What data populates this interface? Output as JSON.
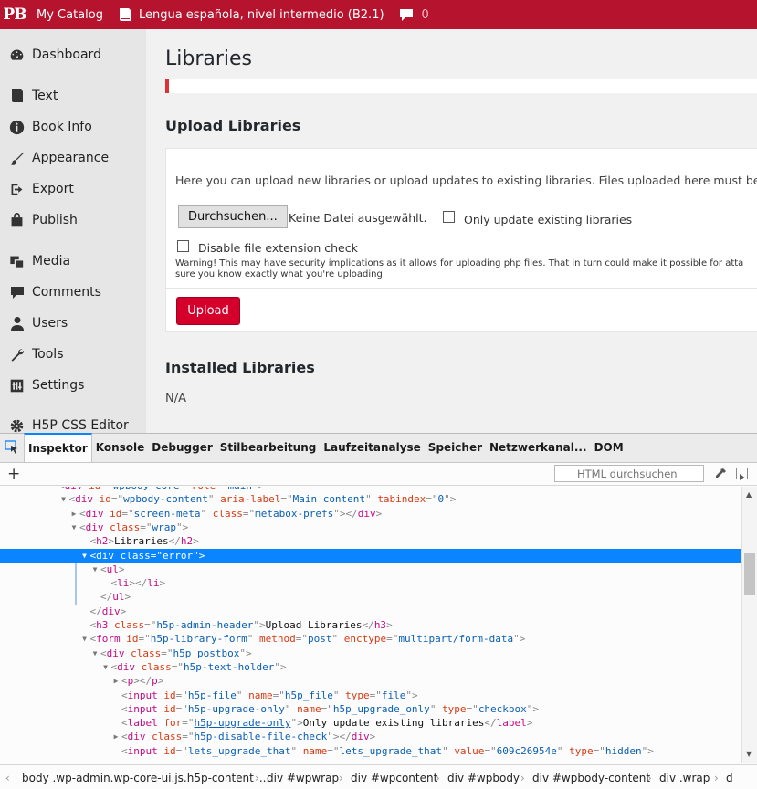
{
  "admin_bar": {
    "logo": "PB",
    "catalog": "My Catalog",
    "book": "Lengua española, nivel intermedio (B2.1)",
    "comments_count": "0"
  },
  "sidebar": {
    "items": [
      {
        "label": "Dashboard",
        "icon": "dashboard-icon"
      },
      {
        "label": "Text",
        "icon": "book-icon"
      },
      {
        "label": "Book Info",
        "icon": "info-icon"
      },
      {
        "label": "Appearance",
        "icon": "brush-icon"
      },
      {
        "label": "Export",
        "icon": "export-icon"
      },
      {
        "label": "Publish",
        "icon": "bag-icon"
      },
      {
        "label": "Media",
        "icon": "media-icon"
      },
      {
        "label": "Comments",
        "icon": "comment-icon"
      },
      {
        "label": "Users",
        "icon": "user-icon"
      },
      {
        "label": "Tools",
        "icon": "wrench-icon"
      },
      {
        "label": "Settings",
        "icon": "settings-icon"
      },
      {
        "label": "H5P CSS Editor",
        "icon": "gear-icon"
      }
    ]
  },
  "main": {
    "title": "Libraries",
    "upload_title": "Upload Libraries",
    "intro": "Here you can upload new libraries or upload updates to existing libraries. Files uploaded here must be in the",
    "file_button": "Durchsuchen...",
    "file_status": "Keine Datei ausgewählt.",
    "only_update_label": "Only update existing libraries",
    "disable_check_label": "Disable file extension check",
    "warning_line1": "Warning! This may have security implications as it allows for uploading php files. That in turn could make it possible for atta",
    "warning_line2": "sure you know exactly what you're uploading.",
    "upload_button": "Upload",
    "installed_title": "Installed Libraries",
    "installed_value": "N/A"
  },
  "devtools": {
    "tabs": [
      "Inspektor",
      "Konsole",
      "Debugger",
      "Stilbearbeitung",
      "Laufzeitanalyse",
      "Speicher",
      "Netzwerkanal...",
      "DOM"
    ],
    "search_placeholder": "HTML durchsuchen",
    "tree": [
      {
        "indent": 0,
        "tw": "none",
        "parts": [
          [
            "p",
            "<"
          ],
          [
            "tag",
            "div"
          ],
          [
            "t",
            " "
          ],
          [
            "attr",
            "id"
          ],
          [
            "p",
            "=\""
          ],
          [
            "val",
            "wpbody-core"
          ],
          [
            "p",
            "\" "
          ],
          [
            "attr",
            "role"
          ],
          [
            "p",
            "=\""
          ],
          [
            "val",
            "main"
          ],
          [
            "p",
            "\">"
          ]
        ]
      },
      {
        "indent": 1,
        "tw": "open",
        "parts": [
          [
            "p",
            "<"
          ],
          [
            "tag",
            "div"
          ],
          [
            "t",
            " "
          ],
          [
            "attr",
            "id"
          ],
          [
            "p",
            "=\""
          ],
          [
            "val",
            "wpbody-content"
          ],
          [
            "p",
            "\" "
          ],
          [
            "attr",
            "aria-label"
          ],
          [
            "p",
            "=\""
          ],
          [
            "val",
            "Main content"
          ],
          [
            "p",
            "\" "
          ],
          [
            "attr",
            "tabindex"
          ],
          [
            "p",
            "=\""
          ],
          [
            "val",
            "0"
          ],
          [
            "p",
            "\">"
          ]
        ]
      },
      {
        "indent": 2,
        "tw": "closed",
        "parts": [
          [
            "p",
            "<"
          ],
          [
            "tag",
            "div"
          ],
          [
            "t",
            " "
          ],
          [
            "attr",
            "id"
          ],
          [
            "p",
            "=\""
          ],
          [
            "val",
            "screen-meta"
          ],
          [
            "p",
            "\" "
          ],
          [
            "attr",
            "class"
          ],
          [
            "p",
            "=\""
          ],
          [
            "val",
            "metabox-prefs"
          ],
          [
            "p",
            "\"></"
          ],
          [
            "tag",
            "div"
          ],
          [
            "p",
            ">"
          ]
        ]
      },
      {
        "indent": 2,
        "tw": "open",
        "parts": [
          [
            "p",
            "<"
          ],
          [
            "tag",
            "div"
          ],
          [
            "t",
            " "
          ],
          [
            "attr",
            "class"
          ],
          [
            "p",
            "=\""
          ],
          [
            "val",
            "wrap"
          ],
          [
            "p",
            "\">"
          ]
        ]
      },
      {
        "indent": 3,
        "tw": "none",
        "parts": [
          [
            "p",
            "<"
          ],
          [
            "tag",
            "h2"
          ],
          [
            "p",
            ">"
          ],
          [
            "t",
            "Libraries"
          ],
          [
            "p",
            "</"
          ],
          [
            "tag",
            "h2"
          ],
          [
            "p",
            ">"
          ]
        ]
      },
      {
        "indent": 3,
        "tw": "open",
        "selected": true,
        "parts": [
          [
            "p",
            "<"
          ],
          [
            "tag",
            "div"
          ],
          [
            "t",
            " "
          ],
          [
            "attr",
            "class"
          ],
          [
            "p",
            "=\""
          ],
          [
            "val",
            "error"
          ],
          [
            "p",
            "\">"
          ]
        ]
      },
      {
        "indent": 4,
        "tw": "open",
        "parts": [
          [
            "p",
            "<"
          ],
          [
            "tag",
            "ul"
          ],
          [
            "p",
            ">"
          ]
        ]
      },
      {
        "indent": 5,
        "tw": "none",
        "parts": [
          [
            "p",
            "<"
          ],
          [
            "tag",
            "li"
          ],
          [
            "p",
            "></"
          ],
          [
            "tag",
            "li"
          ],
          [
            "p",
            ">"
          ]
        ]
      },
      {
        "indent": 4,
        "tw": "none",
        "parts": [
          [
            "p",
            "</"
          ],
          [
            "tag",
            "ul"
          ],
          [
            "p",
            ">"
          ]
        ]
      },
      {
        "indent": 3,
        "tw": "none",
        "parts": [
          [
            "p",
            "</"
          ],
          [
            "tag",
            "div"
          ],
          [
            "p",
            ">"
          ]
        ]
      },
      {
        "indent": 3,
        "tw": "none",
        "parts": [
          [
            "p",
            "<"
          ],
          [
            "tag",
            "h3"
          ],
          [
            "t",
            " "
          ],
          [
            "attr",
            "class"
          ],
          [
            "p",
            "=\""
          ],
          [
            "val",
            "h5p-admin-header"
          ],
          [
            "p",
            "\">"
          ],
          [
            "t",
            "Upload Libraries"
          ],
          [
            "p",
            "</"
          ],
          [
            "tag",
            "h3"
          ],
          [
            "p",
            ">"
          ]
        ]
      },
      {
        "indent": 3,
        "tw": "open",
        "parts": [
          [
            "p",
            "<"
          ],
          [
            "tag",
            "form"
          ],
          [
            "t",
            " "
          ],
          [
            "attr",
            "id"
          ],
          [
            "p",
            "=\""
          ],
          [
            "val",
            "h5p-library-form"
          ],
          [
            "p",
            "\" "
          ],
          [
            "attr",
            "method"
          ],
          [
            "p",
            "=\""
          ],
          [
            "val",
            "post"
          ],
          [
            "p",
            "\" "
          ],
          [
            "attr",
            "enctype"
          ],
          [
            "p",
            "=\""
          ],
          [
            "val",
            "multipart/form-data"
          ],
          [
            "p",
            "\">"
          ]
        ]
      },
      {
        "indent": 4,
        "tw": "open",
        "parts": [
          [
            "p",
            "<"
          ],
          [
            "tag",
            "div"
          ],
          [
            "t",
            " "
          ],
          [
            "attr",
            "class"
          ],
          [
            "p",
            "=\""
          ],
          [
            "val",
            "h5p postbox"
          ],
          [
            "p",
            "\">"
          ]
        ]
      },
      {
        "indent": 5,
        "tw": "open",
        "parts": [
          [
            "p",
            "<"
          ],
          [
            "tag",
            "div"
          ],
          [
            "t",
            " "
          ],
          [
            "attr",
            "class"
          ],
          [
            "p",
            "=\""
          ],
          [
            "val",
            "h5p-text-holder"
          ],
          [
            "p",
            "\">"
          ]
        ]
      },
      {
        "indent": 6,
        "tw": "closed",
        "parts": [
          [
            "p",
            "<"
          ],
          [
            "tag",
            "p"
          ],
          [
            "p",
            "></"
          ],
          [
            "tag",
            "p"
          ],
          [
            "p",
            ">"
          ]
        ]
      },
      {
        "indent": 6,
        "tw": "none",
        "parts": [
          [
            "p",
            "<"
          ],
          [
            "tag",
            "input"
          ],
          [
            "t",
            " "
          ],
          [
            "attr",
            "id"
          ],
          [
            "p",
            "=\""
          ],
          [
            "val",
            "h5p-file"
          ],
          [
            "p",
            "\" "
          ],
          [
            "attr",
            "name"
          ],
          [
            "p",
            "=\""
          ],
          [
            "val",
            "h5p_file"
          ],
          [
            "p",
            "\" "
          ],
          [
            "attr",
            "type"
          ],
          [
            "p",
            "=\""
          ],
          [
            "val",
            "file"
          ],
          [
            "p",
            "\">"
          ]
        ]
      },
      {
        "indent": 6,
        "tw": "none",
        "parts": [
          [
            "p",
            "<"
          ],
          [
            "tag",
            "input"
          ],
          [
            "t",
            " "
          ],
          [
            "attr",
            "id"
          ],
          [
            "p",
            "=\""
          ],
          [
            "val",
            "h5p-upgrade-only"
          ],
          [
            "p",
            "\" "
          ],
          [
            "attr",
            "name"
          ],
          [
            "p",
            "=\""
          ],
          [
            "val",
            "h5p_upgrade_only"
          ],
          [
            "p",
            "\" "
          ],
          [
            "attr",
            "type"
          ],
          [
            "p",
            "=\""
          ],
          [
            "val",
            "checkbox"
          ],
          [
            "p",
            "\">"
          ]
        ]
      },
      {
        "indent": 6,
        "tw": "none",
        "parts": [
          [
            "p",
            "<"
          ],
          [
            "tag",
            "label"
          ],
          [
            "t",
            " "
          ],
          [
            "attr",
            "for"
          ],
          [
            "p",
            "=\""
          ],
          [
            "link",
            "h5p-upgrade-only"
          ],
          [
            "p",
            "\">"
          ],
          [
            "t",
            "Only update existing libraries"
          ],
          [
            "p",
            "</"
          ],
          [
            "tag",
            "label"
          ],
          [
            "p",
            ">"
          ]
        ]
      },
      {
        "indent": 6,
        "tw": "closed",
        "parts": [
          [
            "p",
            "<"
          ],
          [
            "tag",
            "div"
          ],
          [
            "t",
            " "
          ],
          [
            "attr",
            "class"
          ],
          [
            "p",
            "=\""
          ],
          [
            "val",
            "h5p-disable-file-check"
          ],
          [
            "p",
            "\"></"
          ],
          [
            "tag",
            "div"
          ],
          [
            "p",
            ">"
          ]
        ]
      },
      {
        "indent": 6,
        "tw": "none",
        "parts": [
          [
            "p",
            "<"
          ],
          [
            "tag",
            "input"
          ],
          [
            "t",
            " "
          ],
          [
            "attr",
            "id"
          ],
          [
            "p",
            "=\""
          ],
          [
            "val",
            "lets_upgrade_that"
          ],
          [
            "p",
            "\" "
          ],
          [
            "attr",
            "name"
          ],
          [
            "p",
            "=\""
          ],
          [
            "val",
            "lets_upgrade_that"
          ],
          [
            "p",
            "\" "
          ],
          [
            "attr",
            "value"
          ],
          [
            "p",
            "=\""
          ],
          [
            "val",
            "609c26954e"
          ],
          [
            "p",
            "\" "
          ],
          [
            "attr",
            "type"
          ],
          [
            "p",
            "=\""
          ],
          [
            "val",
            "hidden"
          ],
          [
            "p",
            "\">"
          ]
        ]
      }
    ],
    "breadcrumbs": [
      "body .wp-admin.wp-core-ui.js.h5p-content_...",
      "div #wpwrap",
      "div #wpcontent",
      "div #wpbody",
      "div #wpbody-content",
      "div .wrap",
      "d"
    ]
  }
}
